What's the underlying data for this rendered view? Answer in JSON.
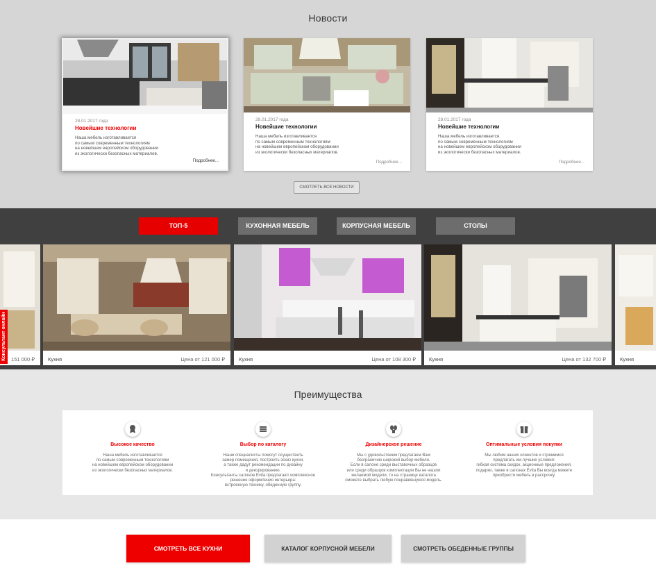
{
  "news": {
    "title": "Новости",
    "cards": [
      {
        "date": "28.01.2017 года",
        "headline": "Новейшие технологии",
        "text": "Наша мебель изготавливается\nпо самым  современным технологиям\nна новейшем европейском оборудовании\nиз экологически безопасных материалов.",
        "more": "Подробнее..."
      },
      {
        "date": "28.01.2017 года",
        "headline": "Новейшие технологии",
        "text": "Наша мебель изготавливается\nпо самым  современным технологиям\nна новейшем европейском оборудовании\nиз экологически безопасных материалов.",
        "more": "Подробнее..."
      },
      {
        "date": "28.01.2017 года",
        "headline": "Новейшие технологии",
        "text": "Наша мебель изготавливается\nпо самым  современным технологиям\nна новейшем европейском оборудовании\nиз экологически безопасных материалов.",
        "more": "Подробнее..."
      }
    ],
    "all_button": "Смотреть все новости"
  },
  "catalog": {
    "tabs": [
      "ТОП-5",
      "КУХОННАЯ МЕБЕЛЬ",
      "КОРПУСНАЯ МЕБЕЛЬ",
      "СТОЛЫ"
    ],
    "active_tab": 0,
    "slides": [
      {
        "caption": "",
        "price": "151 000 ₽"
      },
      {
        "caption": "Кухня",
        "price": "Цена от 121 000 ₽"
      },
      {
        "caption": "Кухня",
        "price": "Цена от 108 300 ₽"
      },
      {
        "caption": "Кухня",
        "price": "Цена от 132 700 ₽"
      },
      {
        "caption": "Кухня",
        "price": ""
      }
    ],
    "consultant": "Консультант онлайн"
  },
  "advantages": {
    "title": "Преимущества",
    "items": [
      {
        "icon": "award-icon",
        "headline": "Высокое качество",
        "text": "Наша мебель изготавливается\nпо самым  современным технологиям\nна новейшем европейском оборудовании\nиз экологически безопасных материалов."
      },
      {
        "icon": "catalog-icon",
        "headline": "Выбор по каталогу",
        "text": "Наши специалисты помогут осуществить\nзамер помещения, построить эскиз кухни,\nа также дадут рекомендации по дизайну\nи декорированию.\nКонсультанты салонов Evita предлагают комплексное\nрешение оформления интерьера:\nвстроенную технику, обеденную группу."
      },
      {
        "icon": "plant-icon",
        "headline": "Дизайнерское решение",
        "text": "Мы с удовольствием предлагаем Вам\nбезграничню широкий выбор мебели.\nЕсли в салоне среди выставочных образцов\nили среди образцов комплектации Вы не нашли\nжелаемой модели, то на странице каталога\nсможете выбрать любую понравившуюся модель."
      },
      {
        "icon": "gift-icon",
        "headline": "Оптимальные условия покупки",
        "text": "Мы любим наших клиентов и стремимся\nпредлагать им лучшие условия:\nгибкая система скидок, акционные предложения,\nподарки, также в салонах Evita Вы всегда можете\nприобрести мебель в рассрочку."
      }
    ]
  },
  "bottom_buttons": [
    "Смотреть все кухни",
    "Каталог корпусной мебели",
    "Смотреть обеденные группы"
  ],
  "colors": {
    "accent": "#e60000",
    "band": "#404040",
    "tab": "#6d6d6d"
  }
}
